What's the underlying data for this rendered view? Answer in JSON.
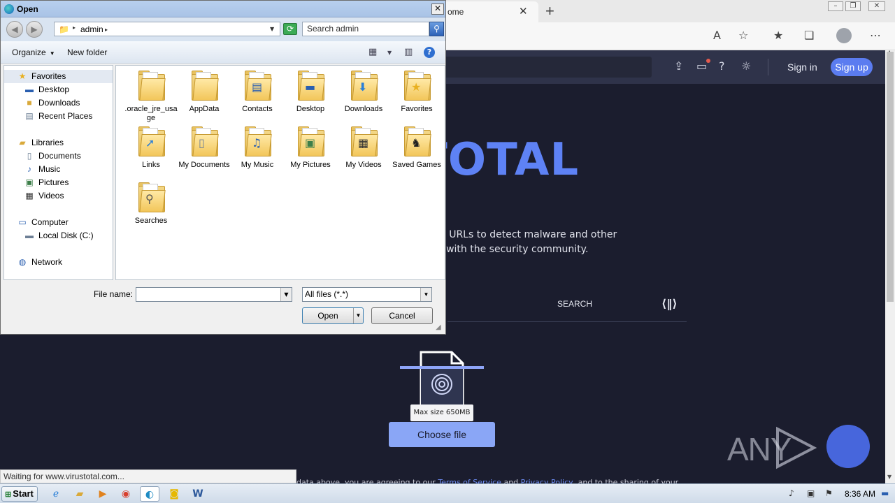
{
  "browser": {
    "tab_title": "ome",
    "close_tab_glyph": "✕",
    "new_tab_glyph": "+",
    "window_controls": [
      "minimize",
      "restore",
      "close"
    ]
  },
  "virustotal": {
    "header": {
      "sign_in": "Sign in",
      "sign_up": "Sign up"
    },
    "logo_text": "USTOTAL",
    "tagline_line1": "nd URLs to detect malware and other",
    "tagline_line2": "m with the security community.",
    "search_tab": "SEARCH",
    "tooltip": "Max size 650MB",
    "choose_file": "Choose file",
    "footer_text": "data above, you are agreeing to our ",
    "footer_link1": "Terms of Service",
    "footer_and": " and ",
    "footer_link2": "Privacy Policy",
    "footer_rest": ", and to the sharing of your"
  },
  "status_bar": {
    "text": "Waiting for www.virustotal.com..."
  },
  "watermark": {
    "text": "ANY"
  },
  "dialog": {
    "title": "Open",
    "address": {
      "path": "admin",
      "search_placeholder": "Search admin"
    },
    "commands": {
      "organize": "Organize",
      "new_folder": "New folder"
    },
    "nav": [
      {
        "label": "Favorites",
        "icon": "star-icon"
      },
      {
        "label": "Desktop",
        "icon": "desktop-icon"
      },
      {
        "label": "Downloads",
        "icon": "downloads-icon"
      },
      {
        "label": "Recent Places",
        "icon": "recent-places-icon"
      },
      {
        "label": "Libraries",
        "icon": "libraries-icon"
      },
      {
        "label": "Documents",
        "icon": "documents-icon"
      },
      {
        "label": "Music",
        "icon": "music-icon"
      },
      {
        "label": "Pictures",
        "icon": "pictures-icon"
      },
      {
        "label": "Videos",
        "icon": "videos-icon"
      },
      {
        "label": "Computer",
        "icon": "computer-icon"
      },
      {
        "label": "Local Disk (C:)",
        "icon": "disk-icon"
      },
      {
        "label": "Network",
        "icon": "network-icon"
      }
    ],
    "files": [
      {
        "label": ".oracle_jre_usage",
        "icon": "folder-icon"
      },
      {
        "label": "AppData",
        "icon": "folder-icon"
      },
      {
        "label": "Contacts",
        "icon": "contacts-folder-icon"
      },
      {
        "label": "Desktop",
        "icon": "desktop-folder-icon"
      },
      {
        "label": "Downloads",
        "icon": "downloads-folder-icon"
      },
      {
        "label": "Favorites",
        "icon": "favorites-folder-icon"
      },
      {
        "label": "Links",
        "icon": "links-folder-icon"
      },
      {
        "label": "My Documents",
        "icon": "documents-folder-icon"
      },
      {
        "label": "My Music",
        "icon": "music-folder-icon"
      },
      {
        "label": "My Pictures",
        "icon": "pictures-folder-icon"
      },
      {
        "label": "My Videos",
        "icon": "videos-folder-icon"
      },
      {
        "label": "Saved Games",
        "icon": "saved-games-folder-icon"
      },
      {
        "label": "Searches",
        "icon": "searches-folder-icon"
      }
    ],
    "file_name_label": "File name:",
    "file_name_value": "",
    "file_type": "All files (*.*)",
    "open_button": "Open",
    "cancel_button": "Cancel"
  },
  "taskbar": {
    "start": "Start",
    "clock": "8:36 AM",
    "apps": [
      "internet-explorer-icon",
      "explorer-icon",
      "media-player-icon",
      "chrome-icon",
      "edge-icon",
      "norton-icon",
      "word-icon"
    ]
  }
}
